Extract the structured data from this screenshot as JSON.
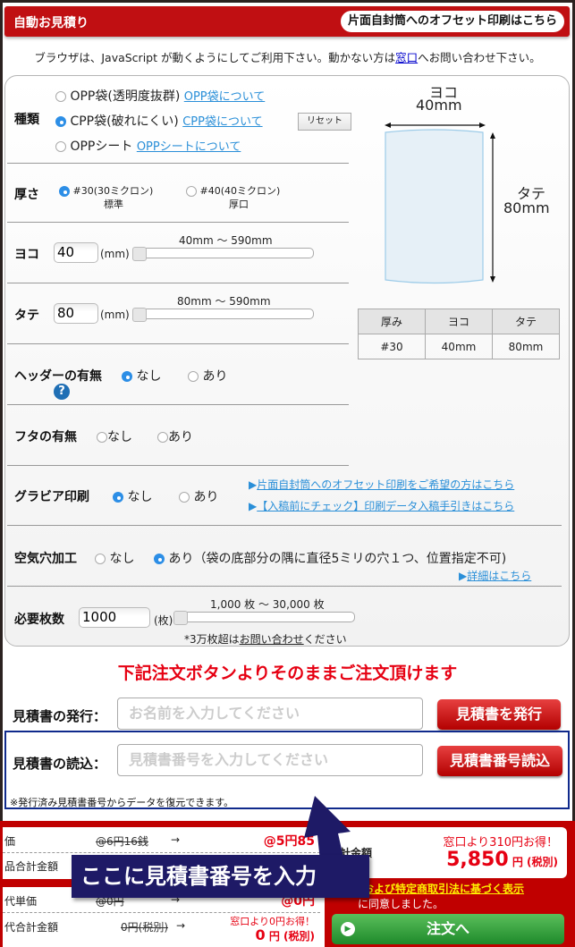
{
  "header": {
    "title": "自動お見積り",
    "offset_link": "片面自封筒へのオフセット印刷はこちら"
  },
  "notice": {
    "before": "ブラウザは、JavaScript が動くようにしてご利用下さい。動かない方は",
    "link": "窓口",
    "after": "へお問い合わせ下さい。"
  },
  "type": {
    "label": "種類",
    "options": [
      {
        "label": "OPP袋(透明度抜群)",
        "link": "OPP袋について",
        "selected": false
      },
      {
        "label": "CPP袋(破れにくい)",
        "link": "CPP袋について",
        "selected": true
      },
      {
        "label": "OPPシート",
        "link": "OPPシートについて",
        "selected": false
      }
    ],
    "reset_label": "リセット"
  },
  "thickness": {
    "label": "厚さ",
    "options": [
      {
        "line1": "#30(30ミクロン)",
        "line2": "標準",
        "selected": true
      },
      {
        "line1": "#40(40ミクロン)",
        "line2": "厚口",
        "selected": false
      }
    ]
  },
  "width": {
    "label": "ヨコ",
    "value": "40",
    "unit": "(mm)",
    "range": "40mm 〜 590mm",
    "slider_fraction": 0
  },
  "height": {
    "label": "タテ",
    "value": "80",
    "unit": "(mm)",
    "range": "80mm 〜 590mm",
    "slider_fraction": 0
  },
  "header_opt": {
    "label": "ヘッダーの有無",
    "none": "なし",
    "yes": "あり",
    "selected": "none",
    "help": "?"
  },
  "lid": {
    "label": "フタの有無",
    "none": "なし",
    "yes": "あり",
    "selected": ""
  },
  "gravure": {
    "label": "グラビア印刷",
    "none": "なし",
    "yes": "あり",
    "selected": "none",
    "link1": "片面自封筒へのオフセット印刷をご希望の方はこちら",
    "link2": "【入稿前にチェック】印刷データ入稿手引きはこちら"
  },
  "airhole": {
    "label": "空気穴加工",
    "none": "なし",
    "yes": "あり（袋の底部分の隅に直径5ミリの穴１つ、位置指定不可)",
    "selected": "yes",
    "detail_link": "詳細はこちら"
  },
  "quantity": {
    "label": "必要枚数",
    "value": "1000",
    "unit": "(枚)",
    "range": "1,000 枚 〜 30,000 枚",
    "slider_fraction": 0,
    "note_before": "*3万枚超は",
    "note_link": "お問い合わせ",
    "note_after": "ください"
  },
  "bag_diagram": {
    "w_label": "ヨコ",
    "w_value": "40mm",
    "h_label": "タテ",
    "h_value": "80mm"
  },
  "summary_table": {
    "headers": [
      "厚み",
      "ヨコ",
      "タテ"
    ],
    "values": [
      "#30",
      "40mm",
      "80mm"
    ]
  },
  "order_note": "下記注文ボタンよりそのままご注文頂けます",
  "estimate_issue": {
    "label": "見積書の発行：",
    "placeholder": "お名前を入力してください",
    "button": "見積書を発行"
  },
  "estimate_load": {
    "label": "見積書の読込：",
    "placeholder": "見積書番号を入力してください",
    "button": "見積書番号読込",
    "note": "※発行済み見積書番号からデータを復元できます。"
  },
  "pricing": {
    "rows": [
      {
        "key": "価",
        "old": "@6円16銭",
        "arrow": "→",
        "new": "@5円85"
      },
      {
        "key": "品合計金額",
        "old": "",
        "arrow": "",
        "new": ""
      },
      {
        "key": "代単価",
        "old": "@0円",
        "arrow": "→",
        "new": "@0円"
      },
      {
        "key": "代合計金額",
        "old": "0円(税別)",
        "arrow": "→",
        "new_note": "窓口より0円お得！",
        "new": "0",
        "new_unit": "円 (税別)"
      }
    ],
    "total_label": "計金額",
    "total_note": "窓口より310円お得！",
    "total_value": "5,850",
    "total_unit": "円 (税別)"
  },
  "agreement": {
    "link": "ータ版および特定商取引法に基づく表示",
    "text": "に同意しました。"
  },
  "order_button": "注文へ",
  "callout": "ここに見積書番号を入力"
}
